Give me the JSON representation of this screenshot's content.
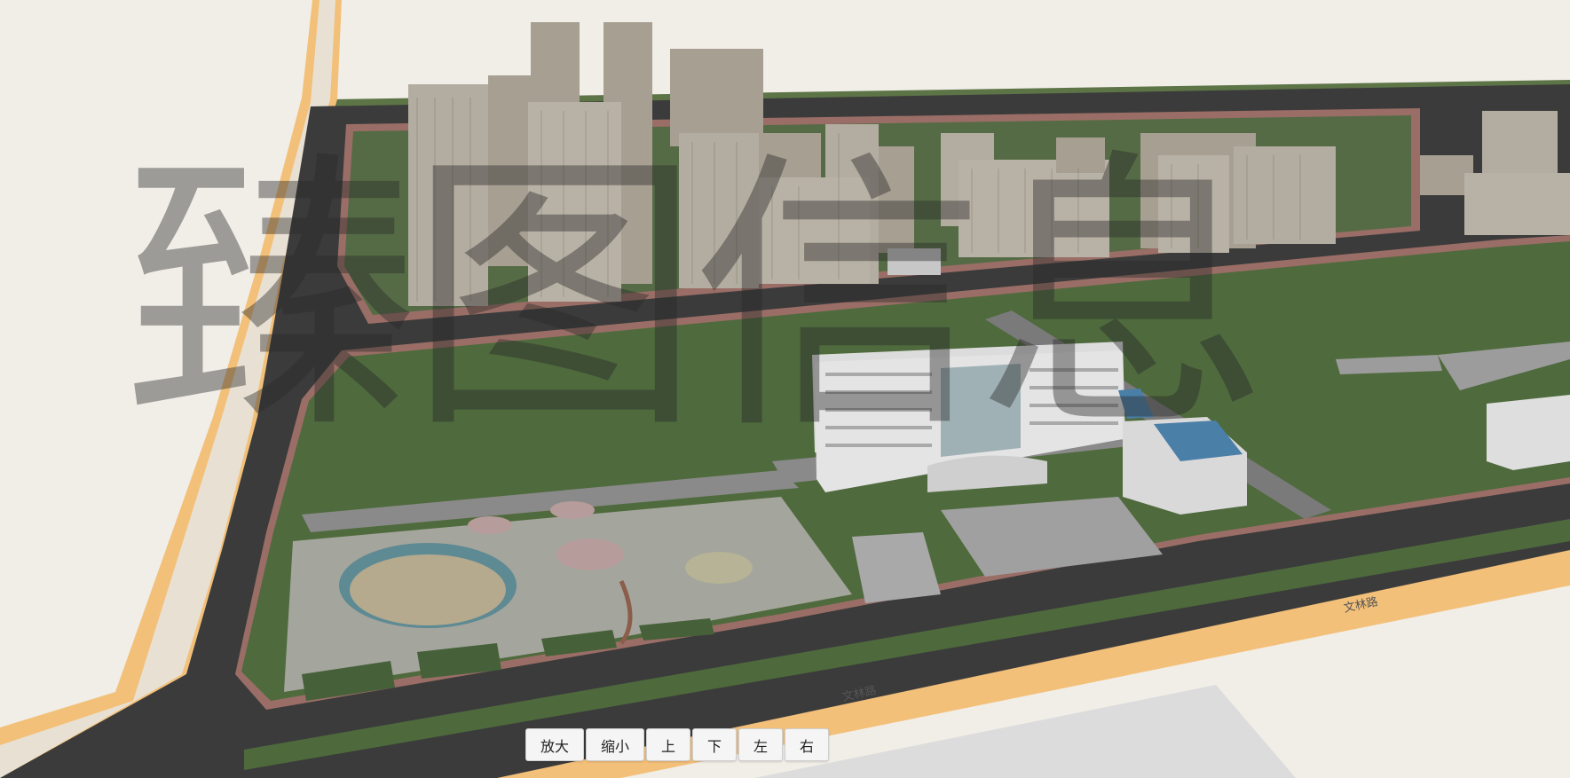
{
  "watermark": {
    "text": "臻图信息"
  },
  "controls": {
    "zoom_in": "放大",
    "zoom_out": "缩小",
    "up": "上",
    "down": "下",
    "left": "左",
    "right": "右"
  },
  "road_labels": {
    "south_road": "文林路",
    "east_road": "文林路"
  },
  "colors": {
    "ground": "#f1eee8",
    "grass": "#4e6a3c",
    "road": "#3b3b3b",
    "curb": "#9a6e66",
    "major_road_edge": "#f3c07a",
    "building_light": "#e6e6e6",
    "tower": "#b3ada1",
    "roof_blue": "#4a7fa8"
  }
}
